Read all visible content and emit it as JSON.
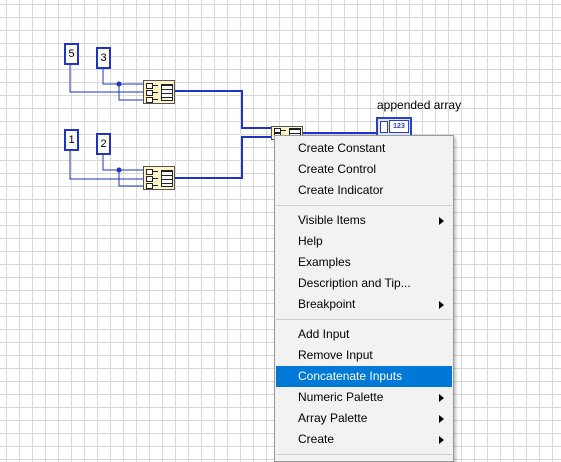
{
  "diagram": {
    "constants": [
      "5",
      "3",
      "1",
      "2"
    ],
    "indicator": {
      "label": "appended array",
      "badge": "123"
    }
  },
  "context_menu": {
    "items": [
      {
        "label": "Create Constant",
        "submenu": false
      },
      {
        "label": "Create Control",
        "submenu": false
      },
      {
        "label": "Create Indicator",
        "submenu": false
      },
      {
        "separator": true
      },
      {
        "label": "Visible Items",
        "submenu": true
      },
      {
        "label": "Help",
        "submenu": false
      },
      {
        "label": "Examples",
        "submenu": false
      },
      {
        "label": "Description and Tip...",
        "submenu": false
      },
      {
        "label": "Breakpoint",
        "submenu": true
      },
      {
        "separator": true
      },
      {
        "label": "Add Input",
        "submenu": false
      },
      {
        "label": "Remove Input",
        "submenu": false
      },
      {
        "label": "Concatenate Inputs",
        "submenu": false,
        "selected": true
      },
      {
        "label": "Numeric Palette",
        "submenu": true
      },
      {
        "label": "Array Palette",
        "submenu": true
      },
      {
        "label": "Create",
        "submenu": true
      },
      {
        "separator": true
      }
    ]
  },
  "colors": {
    "wire": "#1f33c4",
    "selection": "#0078d7",
    "function_fill": "#fff5c8",
    "grid": "#d9d9d9"
  }
}
